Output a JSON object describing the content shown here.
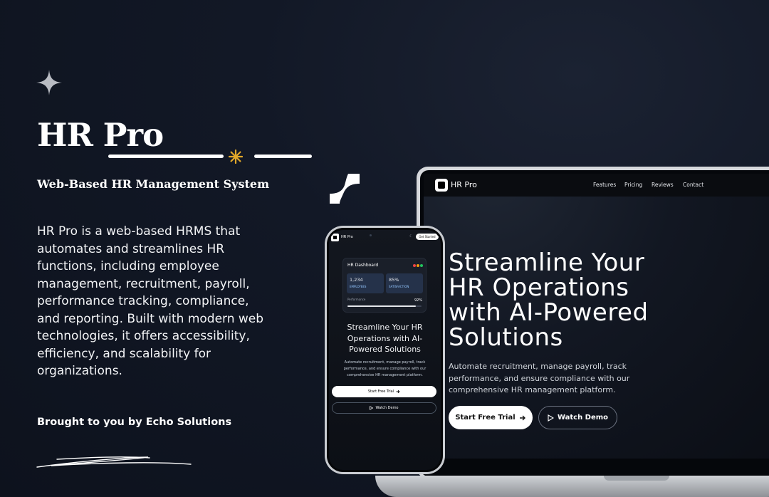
{
  "promo": {
    "title": "HR Pro",
    "subtitle": "Web-Based HR Management System",
    "description": "HR Pro is a web-based HRMS that automates and streamlines HR functions, including employee management, recruitment, payroll, performance tracking, compliance, and reporting. Built with modern web technologies, it offers accessibility, efficiency, and scalability for organizations.",
    "credit": "Brought to you by Echo Solutions",
    "accent_color": "#e2a82a"
  },
  "laptop": {
    "brand": "HR Pro",
    "nav": [
      "Features",
      "Pricing",
      "Reviews",
      "Contact"
    ],
    "hero_title": "Streamline Your HR Operations with AI-Powered Solutions",
    "hero_description": "Automate recruitment, manage payroll, track performance, and ensure compliance with our comprehensive HR management platform.",
    "primary_button": "Start Free Trial",
    "secondary_button": "Watch Demo",
    "icons": [
      "arrow-right-icon",
      "play-icon"
    ]
  },
  "phone": {
    "brand": "HR Pro",
    "get_started": "Get Started",
    "dashboard": {
      "title": "HR Dashboard",
      "status_colors": [
        "#ef4444",
        "#f59e0b",
        "#22c55e"
      ],
      "employees_value": "1,234",
      "employees_label": "EMPLOYEES",
      "satisfaction_value": "85%",
      "satisfaction_label": "SATISFACTION",
      "performance_label": "Performance",
      "performance_value": "92%",
      "performance_fraction": 0.92
    },
    "hero_title": "Streamline Your HR Operations with AI-Powered Solutions",
    "hero_description": "Automate recruitment, manage payroll, track performance, and ensure compliance with our comprehensive HR management platform.",
    "primary_button": "Start Free Trial",
    "secondary_button": "Watch Demo"
  }
}
